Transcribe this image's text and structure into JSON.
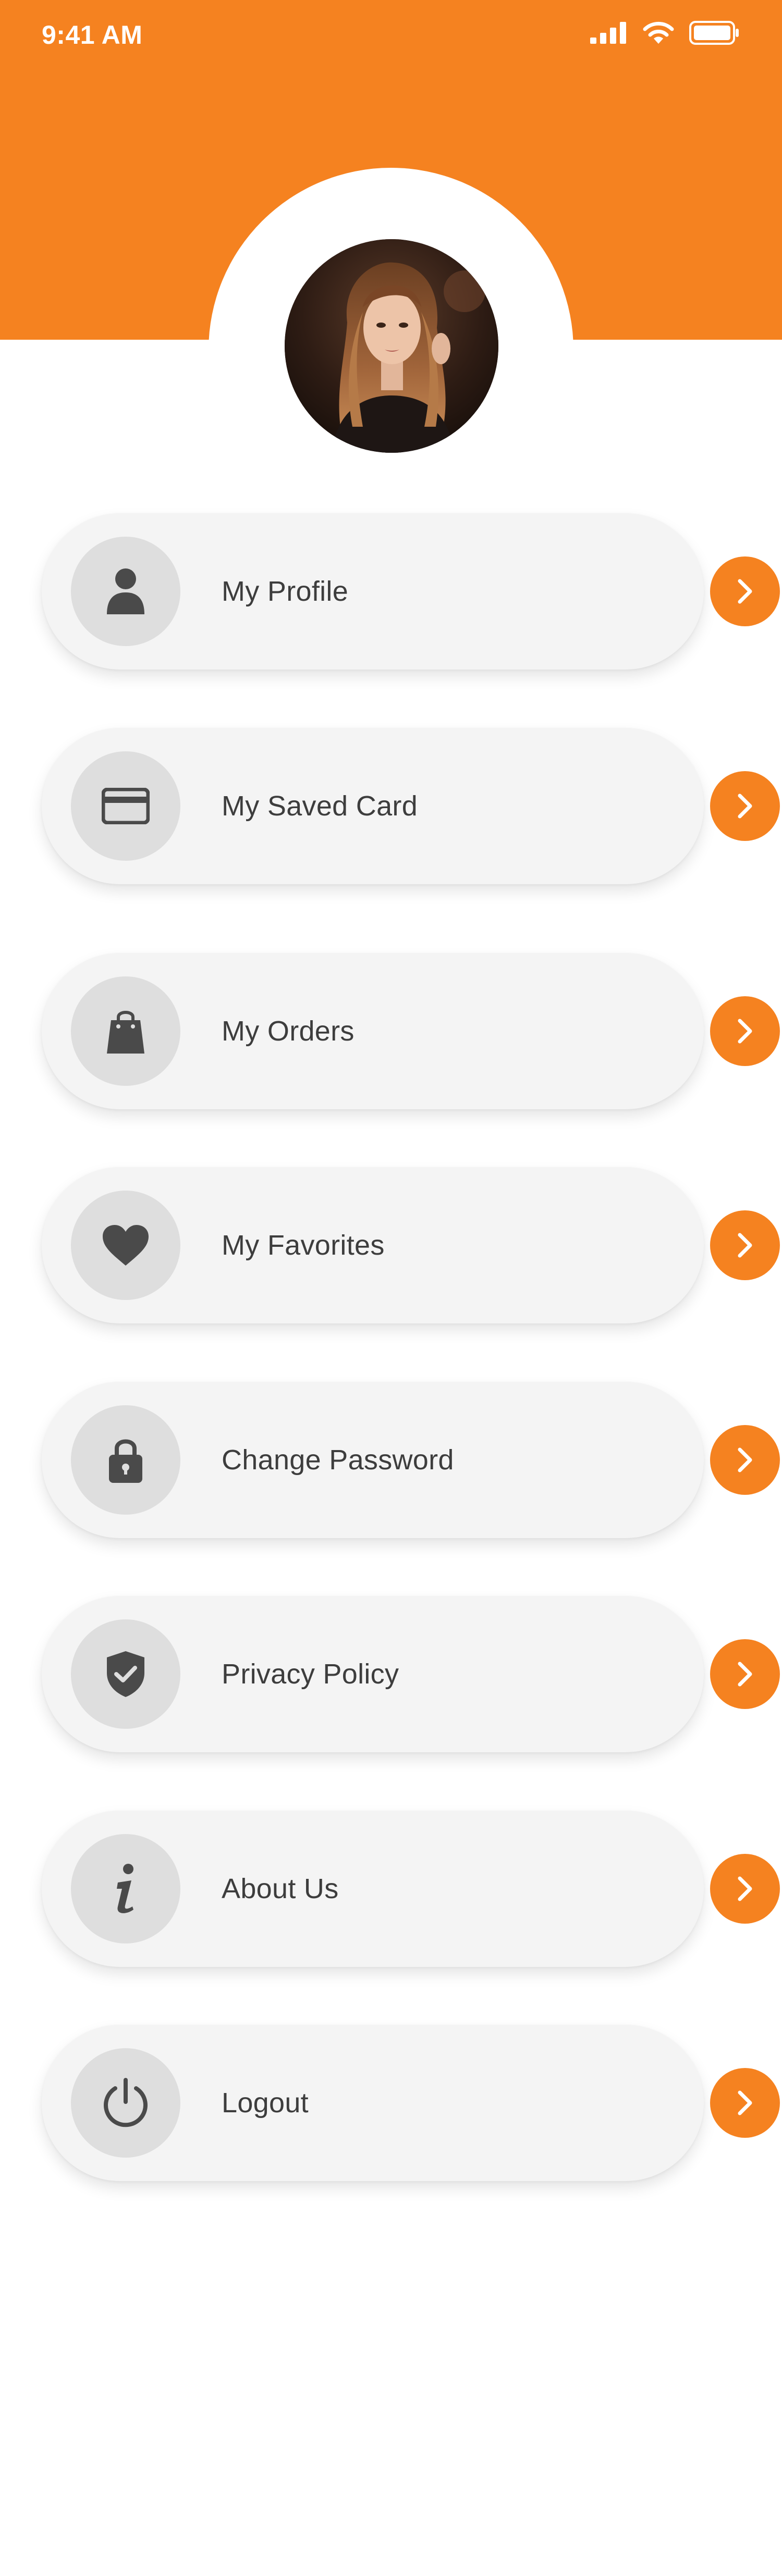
{
  "status_bar": {
    "time": "9:41 AM",
    "icons": [
      "cellular-signal-icon",
      "wifi-icon",
      "battery-icon"
    ]
  },
  "colors": {
    "accent": "#F58220",
    "card_bg": "#f4f4f4",
    "icon_bg": "#dedede",
    "icon_fg": "#4a4a4a",
    "text": "#3d3d3d"
  },
  "profile": {
    "avatar": "profile-photo"
  },
  "menu": {
    "items": [
      {
        "label": "My Profile",
        "icon": "user-icon"
      },
      {
        "label": "My Saved Card",
        "icon": "credit-card-icon"
      },
      {
        "label": "My Orders",
        "icon": "shopping-bag-icon"
      },
      {
        "label": "My Favorites",
        "icon": "heart-icon"
      },
      {
        "label": "Change Password",
        "icon": "lock-icon"
      },
      {
        "label": "Privacy Policy",
        "icon": "shield-check-icon"
      },
      {
        "label": "About Us",
        "icon": "info-icon"
      },
      {
        "label": "Logout",
        "icon": "power-icon"
      }
    ]
  }
}
